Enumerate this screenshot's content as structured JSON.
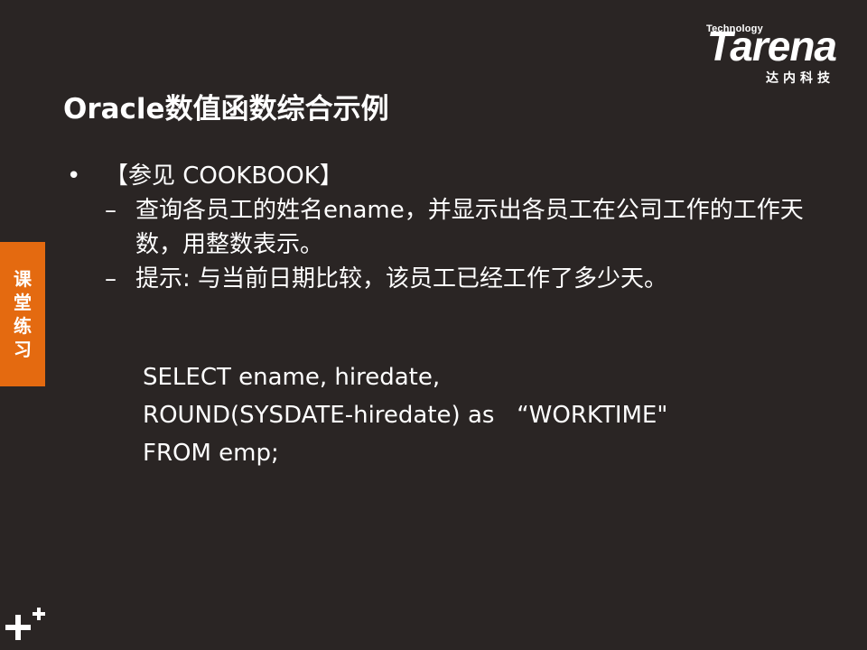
{
  "logo": {
    "tech": "Technology",
    "brand": "Tarena",
    "sub": "达内科技"
  },
  "title": "Oracle数值函数综合示例",
  "side_tab": [
    "课",
    "堂",
    "练",
    "习"
  ],
  "bullet": {
    "marker": "•",
    "text": "【参见 COOKBOOK】"
  },
  "sub_items": [
    {
      "marker": "–",
      "text": "查询各员工的姓名ename，并显示出各员工在公司工作的工作天数，用整数表示。"
    },
    {
      "marker": "–",
      "text": "提示: 与当前日期比较，该员工已经工作了多少天。"
    }
  ],
  "code": [
    "SELECT ename, hiredate,",
    "ROUND(SYSDATE-hiredate) as   “WORKTIME\"",
    "FROM emp;"
  ],
  "colors": {
    "background": "#2a2524",
    "accent": "#e46a10",
    "text": "#ffffff"
  },
  "icons": {
    "corner": "plus-icon"
  }
}
